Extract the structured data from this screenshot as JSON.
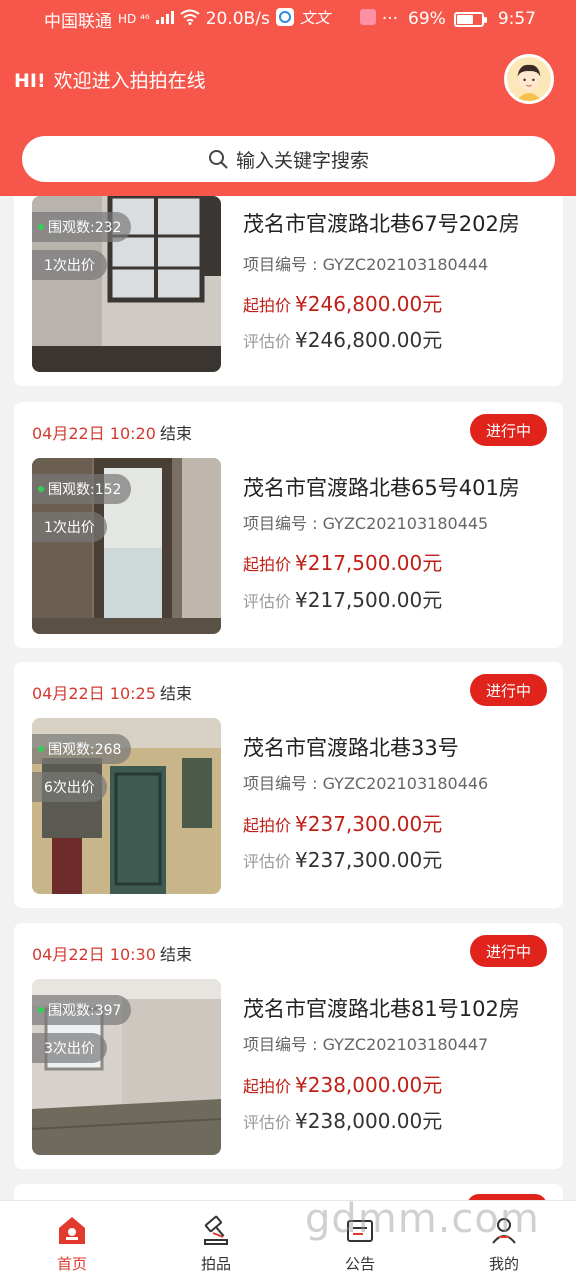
{
  "status_bar": {
    "carrier": "中国联通",
    "network_badges": "HD ⁴⁶",
    "speed": "20.0B/s",
    "more": "···",
    "battery_percent": "69%",
    "battery_level": 0.69,
    "time": "9:57"
  },
  "header": {
    "hi": "HI!",
    "greeting": "欢迎进入拍拍在线",
    "search_placeholder": "输入关键字搜索"
  },
  "listings": [
    {
      "time": "",
      "ended": "",
      "status": "",
      "views": "围观数:232",
      "bids": "1次出价",
      "title": "茂名市官渡路北巷67号202房",
      "code": "项目编号 : GYZC202103180444",
      "start_label": "起拍价",
      "start_price": "¥246,800.00元",
      "appraise_label": "评估价",
      "appraise_price": "¥246,800.00元"
    },
    {
      "time": "04月22日 10:20",
      "ended": "结束",
      "status": "进行中",
      "views": "围观数:152",
      "bids": "1次出价",
      "title": "茂名市官渡路北巷65号401房",
      "code": "项目编号 : GYZC202103180445",
      "start_label": "起拍价",
      "start_price": "¥217,500.00元",
      "appraise_label": "评估价",
      "appraise_price": "¥217,500.00元"
    },
    {
      "time": "04月22日 10:25",
      "ended": "结束",
      "status": "进行中",
      "views": "围观数:268",
      "bids": "6次出价",
      "title": "茂名市官渡路北巷33号",
      "code": "项目编号 : GYZC202103180446",
      "start_label": "起拍价",
      "start_price": "¥237,300.00元",
      "appraise_label": "评估价",
      "appraise_price": "¥237,300.00元"
    },
    {
      "time": "04月22日 10:30",
      "ended": "结束",
      "status": "进行中",
      "views": "围观数:397",
      "bids": "3次出价",
      "title": "茂名市官渡路北巷81号102房",
      "code": "项目编号 : GYZC202103180447",
      "start_label": "起拍价",
      "start_price": "¥238,000.00元",
      "appraise_label": "评估价",
      "appraise_price": "¥238,000.00元"
    }
  ],
  "tabs": [
    {
      "label": "首页",
      "icon": "home-icon",
      "active": true
    },
    {
      "label": "拍品",
      "icon": "gavel-icon",
      "active": false
    },
    {
      "label": "公告",
      "icon": "notice-icon",
      "active": false
    },
    {
      "label": "我的",
      "icon": "user-icon",
      "active": false
    }
  ],
  "watermark": "gdmm.com",
  "colors": {
    "header_bg": "#f7564a",
    "accent_red": "#e0231b",
    "price_red": "#c01e16",
    "active_tab": "#e23a2e"
  }
}
